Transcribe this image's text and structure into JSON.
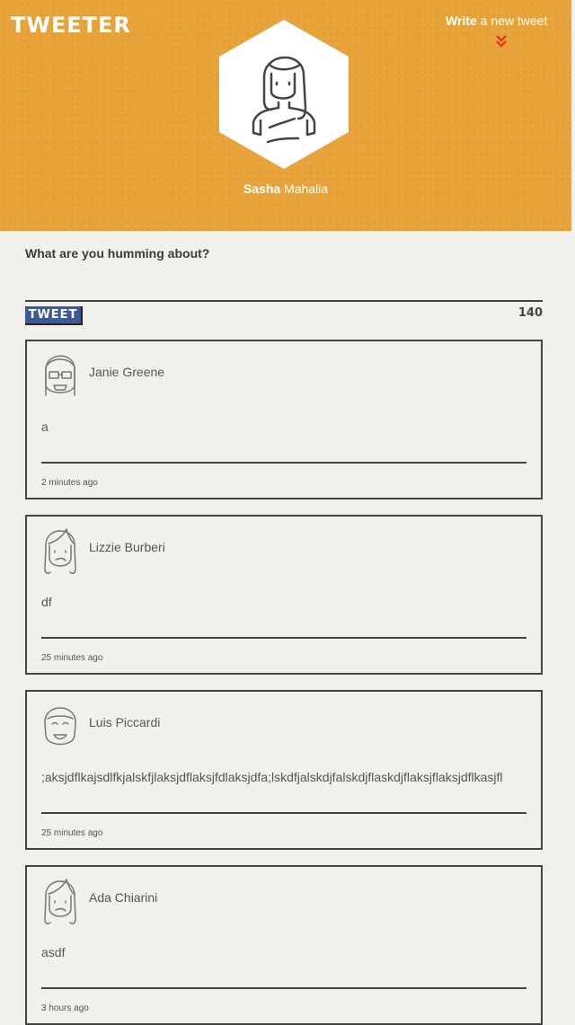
{
  "app": {
    "title": "TWEETER"
  },
  "header": {
    "write_link": {
      "bold": "Write",
      "rest": " a new tweet"
    },
    "profile": {
      "first": "Sasha",
      "last": " Mahalia"
    },
    "colors": {
      "background": "#e8a43a",
      "chevron": "#e23a1e"
    }
  },
  "compose": {
    "prompt": "What are you humming about?",
    "value": "",
    "placeholder": "",
    "button_label": "TWEET",
    "char_count": "140",
    "button_color": "#3d5a97"
  },
  "tweets": [
    {
      "author": "Janie Greene",
      "body": "a",
      "time": "2 minutes ago",
      "avatar": "woman-glasses-avatar-icon"
    },
    {
      "author": "Lizzie Burberi",
      "body": "df",
      "time": "25 minutes ago",
      "avatar": "woman-avatar-icon"
    },
    {
      "author": "Luis Piccardi",
      "body": ";aksjdflkajsdlfkjalskfjlaksjdflaksjfdlaksjdfa;lskdfjalskdjfalskdjflaskdjflaksjflaksjdflkasjfl",
      "time": "25 minutes ago",
      "avatar": "man-avatar-icon"
    },
    {
      "author": "Ada Chiarini",
      "body": "asdf",
      "time": "3 hours ago",
      "avatar": "woman-avatar-icon"
    }
  ]
}
